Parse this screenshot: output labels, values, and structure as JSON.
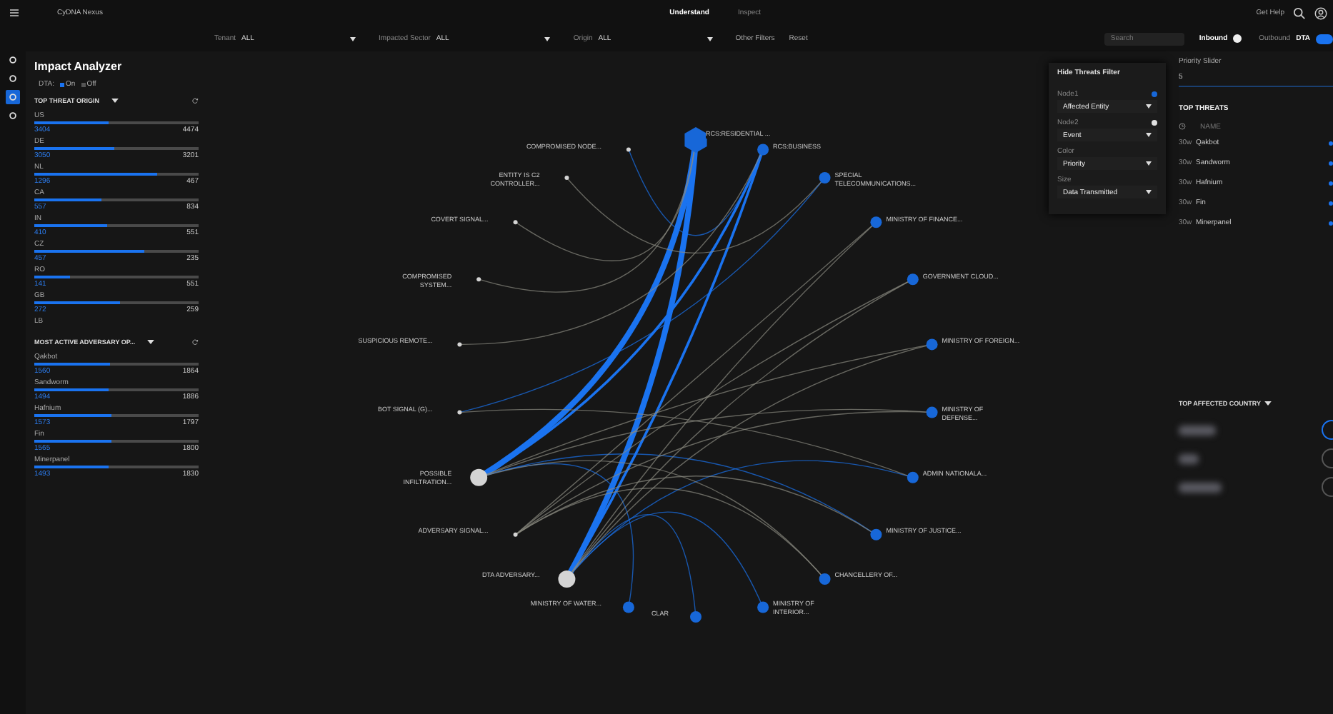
{
  "app": {
    "title": "CyDNA Nexus"
  },
  "tabs": [
    {
      "label": "Understand",
      "selected": true
    },
    {
      "label": "Inspect",
      "selected": false
    }
  ],
  "help": {
    "label": "Get Help"
  },
  "filters": [
    {
      "label": "Tenant",
      "value": "ALL"
    },
    {
      "label": "Impacted Sector",
      "value": "ALL"
    },
    {
      "label": "Origin",
      "value": "ALL"
    }
  ],
  "other_filters": "Other Filters",
  "reset": "Reset",
  "search": {
    "placeholder": "Search"
  },
  "direction": [
    {
      "label": "Inbound",
      "selected": true
    },
    {
      "label": "Outbound",
      "selected": false
    }
  ],
  "dta_switch": {
    "label": "DTA",
    "on": true
  },
  "rail": [
    {
      "selected": false
    },
    {
      "selected": false
    },
    {
      "selected": true
    },
    {
      "selected": false
    }
  ],
  "panel": {
    "title": "Impact Analyzer",
    "dta_label": "DTA:",
    "dta_options": [
      {
        "label": "On",
        "selected": true
      },
      {
        "label": "Off",
        "selected": false
      }
    ],
    "sections": [
      {
        "title": "TOP THREAT ORIGIN",
        "items": [
          {
            "name": "US",
            "value": "3404",
            "total": "4474",
            "level": 0.45
          },
          {
            "name": "DE",
            "value": "3050",
            "total": "3201",
            "level": 0.49
          },
          {
            "name": "NL",
            "value": "1296",
            "total": "467",
            "level": 0.75
          },
          {
            "name": "CA",
            "value": "557",
            "total": "834",
            "level": 0.41
          },
          {
            "name": "IN",
            "value": "410",
            "total": "551",
            "level": 0.44
          },
          {
            "name": "CZ",
            "value": "457",
            "total": "235",
            "level": 0.67
          },
          {
            "name": "RO",
            "value": "141",
            "total": "551",
            "level": 0.22
          },
          {
            "name": "GB",
            "value": "272",
            "total": "259",
            "level": 0.52
          },
          {
            "name": "LB"
          }
        ]
      },
      {
        "title": "MOST ACTIVE ADVERSARY OP...",
        "items": [
          {
            "name": "Qakbot",
            "value": "1560",
            "total": "1864",
            "level": 0.46
          },
          {
            "name": "Sandworm",
            "value": "1494",
            "total": "1886",
            "level": 0.45
          },
          {
            "name": "Hafnium",
            "value": "1573",
            "total": "1797",
            "level": 0.47
          },
          {
            "name": "Fin",
            "value": "1565",
            "total": "1800",
            "level": 0.47
          },
          {
            "name": "Minerpanel",
            "value": "1493",
            "total": "1830",
            "level": 0.45
          }
        ]
      }
    ]
  },
  "graph": {
    "right_nodes": [
      {
        "label": "RCS:RESIDENTIAL ...",
        "kind": "hexagon",
        "color": "#1767d8"
      },
      {
        "label": "RCS:BUSINESS",
        "kind": "dot",
        "color": "#1767d8"
      },
      {
        "label": "SPECIAL TELECOMMUNICATIONS...",
        "kind": "dot",
        "color": "#1767d8"
      },
      {
        "label": "MINISTRY OF FINANCE...",
        "kind": "dot",
        "color": "#1767d8"
      },
      {
        "label": "GOVERNMENT CLOUD...",
        "kind": "dot",
        "color": "#1767d8"
      },
      {
        "label": "MINISTRY OF FOREIGN...",
        "kind": "dot",
        "color": "#1767d8"
      },
      {
        "label": "MINISTRY OF DEFENSE...",
        "kind": "dot",
        "color": "#1767d8"
      },
      {
        "label": "ADMIN NATIONALA...",
        "kind": "dot",
        "color": "#1767d8"
      },
      {
        "label": "MINISTRY OF JUSTICE...",
        "kind": "dot",
        "color": "#1767d8"
      },
      {
        "label": "CHANCELLERY OF...",
        "kind": "dot",
        "color": "#1767d8"
      },
      {
        "label": "MINISTRY OF INTERIOR...",
        "kind": "dot",
        "color": "#1767d8"
      }
    ],
    "left_nodes": [
      {
        "label": "COMPROMISED NODE...",
        "kind": "point",
        "color": "#d4d4d4"
      },
      {
        "label": "ENTITY IS C2 CONTROLLER...",
        "kind": "point",
        "color": "#d4d4d4"
      },
      {
        "label": "COVERT SIGNAL...",
        "kind": "point",
        "color": "#d4d4d4"
      },
      {
        "label": "COMPROMISED SYSTEM...",
        "kind": "point",
        "color": "#d4d4d4"
      },
      {
        "label": "SUSPICIOUS REMOTE...",
        "kind": "point",
        "color": "#d4d4d4"
      },
      {
        "label": "BOT SIGNAL (G)...",
        "kind": "point",
        "color": "#d4d4d4"
      },
      {
        "label": "POSSIBLE INFILTRATION...",
        "kind": "disc",
        "color": "#d4d4d4"
      },
      {
        "label": "ADVERSARY SIGNAL...",
        "kind": "point",
        "color": "#d4d4d4"
      },
      {
        "label": "DTA ADVERSARY...",
        "kind": "disc",
        "color": "#d4d4d4"
      },
      {
        "label": "MINISTRY OF WATER...",
        "kind": "dot",
        "color": "#1767d8"
      },
      {
        "label": "CLAR",
        "kind": "dot",
        "color": "#1767d8"
      }
    ]
  },
  "threat_filter": {
    "toggle": "Hide Threats Filter",
    "fields": [
      {
        "label": "Node1",
        "value": "Affected Entity",
        "color": "#1767d8"
      },
      {
        "label": "Node2",
        "value": "Event",
        "color": "#e0e0e0"
      },
      {
        "label": "Color",
        "value": "Priority"
      },
      {
        "label": "Size",
        "value": "Data Transmitted"
      }
    ]
  },
  "priority": {
    "title": "Priority Slider",
    "value": "5"
  },
  "top_threats": {
    "title": "TOP THREATS",
    "column": "NAME",
    "rows": [
      {
        "age": "30w",
        "name": "Qakbot"
      },
      {
        "age": "30w",
        "name": "Sandworm"
      },
      {
        "age": "30w",
        "name": "Hafnium"
      },
      {
        "age": "30w",
        "name": "Fin"
      },
      {
        "age": "30w",
        "name": "Minerpanel"
      }
    ]
  },
  "top_affected": {
    "title": "TOP AFFECTED COUNTRY",
    "rows": [
      {
        "kind": "blurred"
      },
      {
        "kind": "blurred"
      },
      {
        "kind": "blurred"
      }
    ]
  }
}
